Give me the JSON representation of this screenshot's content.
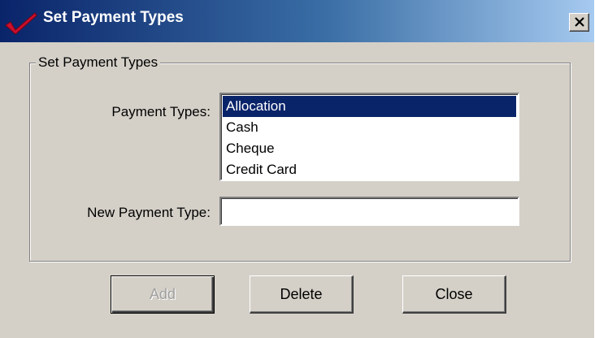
{
  "window": {
    "title": "Set Payment Types",
    "close_icon": "close-x-icon",
    "title_icon": "checkmark-icon",
    "colors": {
      "titlebar_start": "#0a246a",
      "titlebar_end": "#a6caf0",
      "face": "#d4d0c8",
      "selection": "#0a246a"
    }
  },
  "group": {
    "legend": "Set Payment Types",
    "payment_types_label": "Payment Types:",
    "payment_types": [
      {
        "label": "Allocation",
        "selected": true
      },
      {
        "label": "Cash",
        "selected": false
      },
      {
        "label": "Cheque",
        "selected": false
      },
      {
        "label": "Credit Card",
        "selected": false
      }
    ],
    "new_payment_type_label": "New Payment Type:",
    "new_payment_type_value": ""
  },
  "buttons": {
    "add": {
      "label": "Add",
      "enabled": false
    },
    "delete": {
      "label": "Delete",
      "enabled": true
    },
    "close": {
      "label": "Close",
      "enabled": true
    }
  }
}
